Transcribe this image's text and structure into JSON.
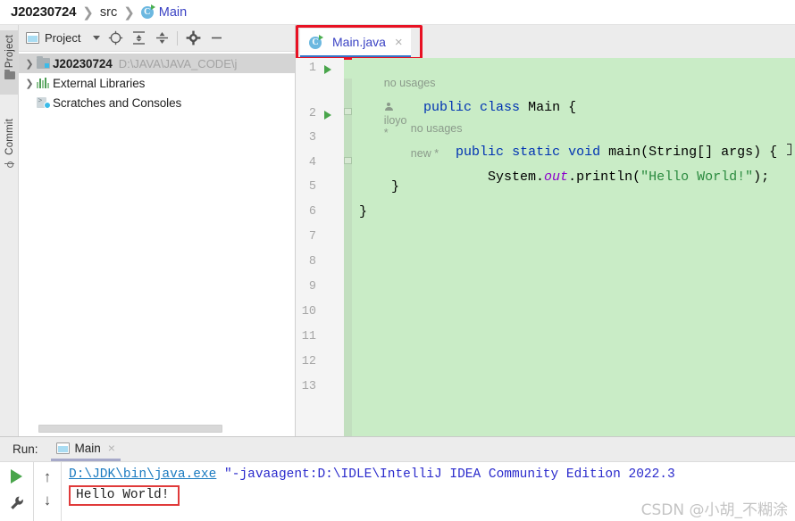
{
  "breadcrumb": {
    "project": "J20230724",
    "src": "src",
    "classname": "Main",
    "separator": "❯",
    "class_icon": "class-c-icon"
  },
  "left_stripe": {
    "tabs": [
      {
        "label": "Project",
        "icon": "folder-icon",
        "active": true
      },
      {
        "label": "Commit",
        "icon": "commit-branch-icon",
        "active": false
      }
    ]
  },
  "project_panel": {
    "toolbar": {
      "title": "Project",
      "window_icon": "project-window-icon",
      "dropdown_caret": "caret-down-icon",
      "buttons": [
        {
          "name": "locate-icon",
          "glyph": "⊕"
        },
        {
          "name": "expand-all-icon",
          "glyph": "↥"
        },
        {
          "name": "collapse-all-icon",
          "glyph": "↧"
        },
        {
          "name": "settings-gear-icon",
          "glyph": "⚙"
        },
        {
          "name": "hide-window-icon",
          "glyph": "—"
        }
      ]
    },
    "tree": [
      {
        "name": "J20230724",
        "path": "D:\\JAVA\\JAVA_CODE\\j",
        "icon": "module-icon",
        "arrow": "❯",
        "selected": true,
        "bold": true
      },
      {
        "name": "External Libraries",
        "path": "",
        "icon": "library-icon",
        "arrow": "❯",
        "selected": false,
        "bold": false
      },
      {
        "name": "Scratches and Consoles",
        "path": "",
        "icon": "scratches-icon",
        "arrow": "",
        "selected": false,
        "bold": false
      }
    ],
    "scrollbar": "horizontal-scrollbar"
  },
  "editor": {
    "tab": {
      "filename": "Main.java",
      "icon": "class-c-icon",
      "close": "×",
      "highlighted": true,
      "highlight_color": "#e81123"
    },
    "line_numbers": [
      1,
      2,
      3,
      4,
      5,
      6,
      7,
      8,
      9,
      10,
      11,
      12,
      13
    ],
    "run_gutter_lines": [
      1,
      2
    ],
    "background_color": "#c9ecc6",
    "hints": [
      {
        "text": "no usages",
        "author": "iloyo",
        "modified": "*",
        "indent": 0
      },
      {
        "text": "no usages",
        "author": "",
        "modified": "new *",
        "indent": 1
      }
    ],
    "code_lines": [
      {
        "n": 1,
        "tokens": [
          {
            "t": "public",
            "c": "kw"
          },
          {
            "t": " ",
            "c": "ident"
          },
          {
            "t": "class",
            "c": "kw"
          },
          {
            "t": " ",
            "c": "ident"
          },
          {
            "t": "Main",
            "c": "ident"
          },
          {
            "t": " {",
            "c": "ident"
          }
        ]
      },
      {
        "n": 2,
        "tokens": [
          {
            "t": "    ",
            "c": "ident"
          },
          {
            "t": "public",
            "c": "kw"
          },
          {
            "t": " ",
            "c": "ident"
          },
          {
            "t": "static",
            "c": "kw"
          },
          {
            "t": " ",
            "c": "ident"
          },
          {
            "t": "void",
            "c": "kw"
          },
          {
            "t": " ",
            "c": "ident"
          },
          {
            "t": "main",
            "c": "ident"
          },
          {
            "t": "(",
            "c": "ident"
          },
          {
            "t": "String",
            "c": "ident"
          },
          {
            "t": "[] args) {",
            "c": "ident"
          }
        ]
      },
      {
        "n": 3,
        "tokens": [
          {
            "t": "        System.",
            "c": "ident"
          },
          {
            "t": "out",
            "c": "fld"
          },
          {
            "t": ".println(",
            "c": "ident"
          },
          {
            "t": "\"Hello World!\"",
            "c": "str"
          },
          {
            "t": ");",
            "c": "ident"
          }
        ]
      },
      {
        "n": 4,
        "tokens": [
          {
            "t": "    }",
            "c": "ident"
          }
        ]
      },
      {
        "n": 5,
        "tokens": [
          {
            "t": "}",
            "c": "ident"
          }
        ]
      }
    ]
  },
  "run_panel": {
    "label": "Run:",
    "tab": {
      "name": "Main",
      "icon": "run-config-icon",
      "close": "×"
    },
    "side_buttons": [
      {
        "name": "rerun-button",
        "glyph": "play-triangle-icon"
      },
      {
        "name": "run-settings-button",
        "glyph": "wrench-icon"
      }
    ],
    "side_buttons_2": [
      {
        "name": "prev-occurrence-button",
        "glyph": "↑"
      },
      {
        "name": "next-occurrence-button",
        "glyph": "↓"
      }
    ],
    "console": {
      "java_exe_path": "D:\\JDK\\bin\\java.exe",
      "command_args": " \"-javaagent:D:\\IDLE\\IntelliJ IDEA Community Edition 2022.3",
      "output": "Hello World!",
      "output_highlighted": true,
      "highlight_color": "#e03a3a"
    }
  },
  "watermark": "CSDN @小胡_不糊涂"
}
